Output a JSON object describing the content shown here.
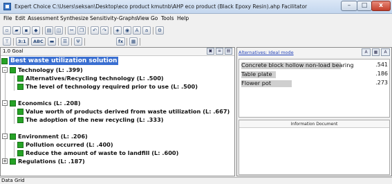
{
  "window": {
    "title": "Expert Choice   C:\\Users\\seksan\\Desktop\\eco product kmutnb\\AHP eco product (Black Epoxy Resin).ahp   Facilitator",
    "min_label": "–",
    "max_label": "□",
    "close_label": "x"
  },
  "menu": {
    "file": "File",
    "edit": "Edit",
    "assessment": "Assessment",
    "synthesize": "Synthesize",
    "sensitivity": "Sensitivity-Graphs",
    "view": "View",
    "go": "Go",
    "tools": "Tools",
    "help": "Help"
  },
  "toolbar": {
    "t_31": "3:1",
    "t_abc": "ABC",
    "t_fx": "fx"
  },
  "left_pane": {
    "header": "1.0 Goal",
    "goal": "Best waste utilization solution",
    "nodes": [
      {
        "label": "Technology (L: .399)"
      },
      {
        "label": "Alternatives/Recycling technology (L: .500)"
      },
      {
        "label": "The level of technology required prior to use (L: .500)"
      },
      {
        "label": "Economics (L: .208)"
      },
      {
        "label": "Value worth of products derived from waste utilization (L: .667)"
      },
      {
        "label": "The adoption of the new recycling (L: .333)"
      },
      {
        "label": "Environment (L: .206)"
      },
      {
        "label": "Pollution occurred (L: .400)"
      },
      {
        "label": "Reduce the amount of waste to landfill (L: .600)"
      },
      {
        "label": "Regulations (L: .187)"
      }
    ],
    "expanders": [
      "–",
      "–",
      "–",
      "+"
    ]
  },
  "right_pane": {
    "link": "Alternatives: Ideal mode",
    "alternatives": [
      {
        "name": "Concrete block hollow non-load bearing",
        "value": ".541",
        "fraction": 0.541
      },
      {
        "name": "Table plate",
        "value": ".186",
        "fraction": 0.186
      },
      {
        "name": "Flower pot",
        "value": ".273",
        "fraction": 0.273
      }
    ],
    "info_title": "Information Document"
  },
  "status": {
    "text": "Data Grid"
  },
  "colors": {
    "node_box": "#26a326",
    "goal_highlight": "#3a6fd1",
    "bar": "#cfcfcf"
  }
}
